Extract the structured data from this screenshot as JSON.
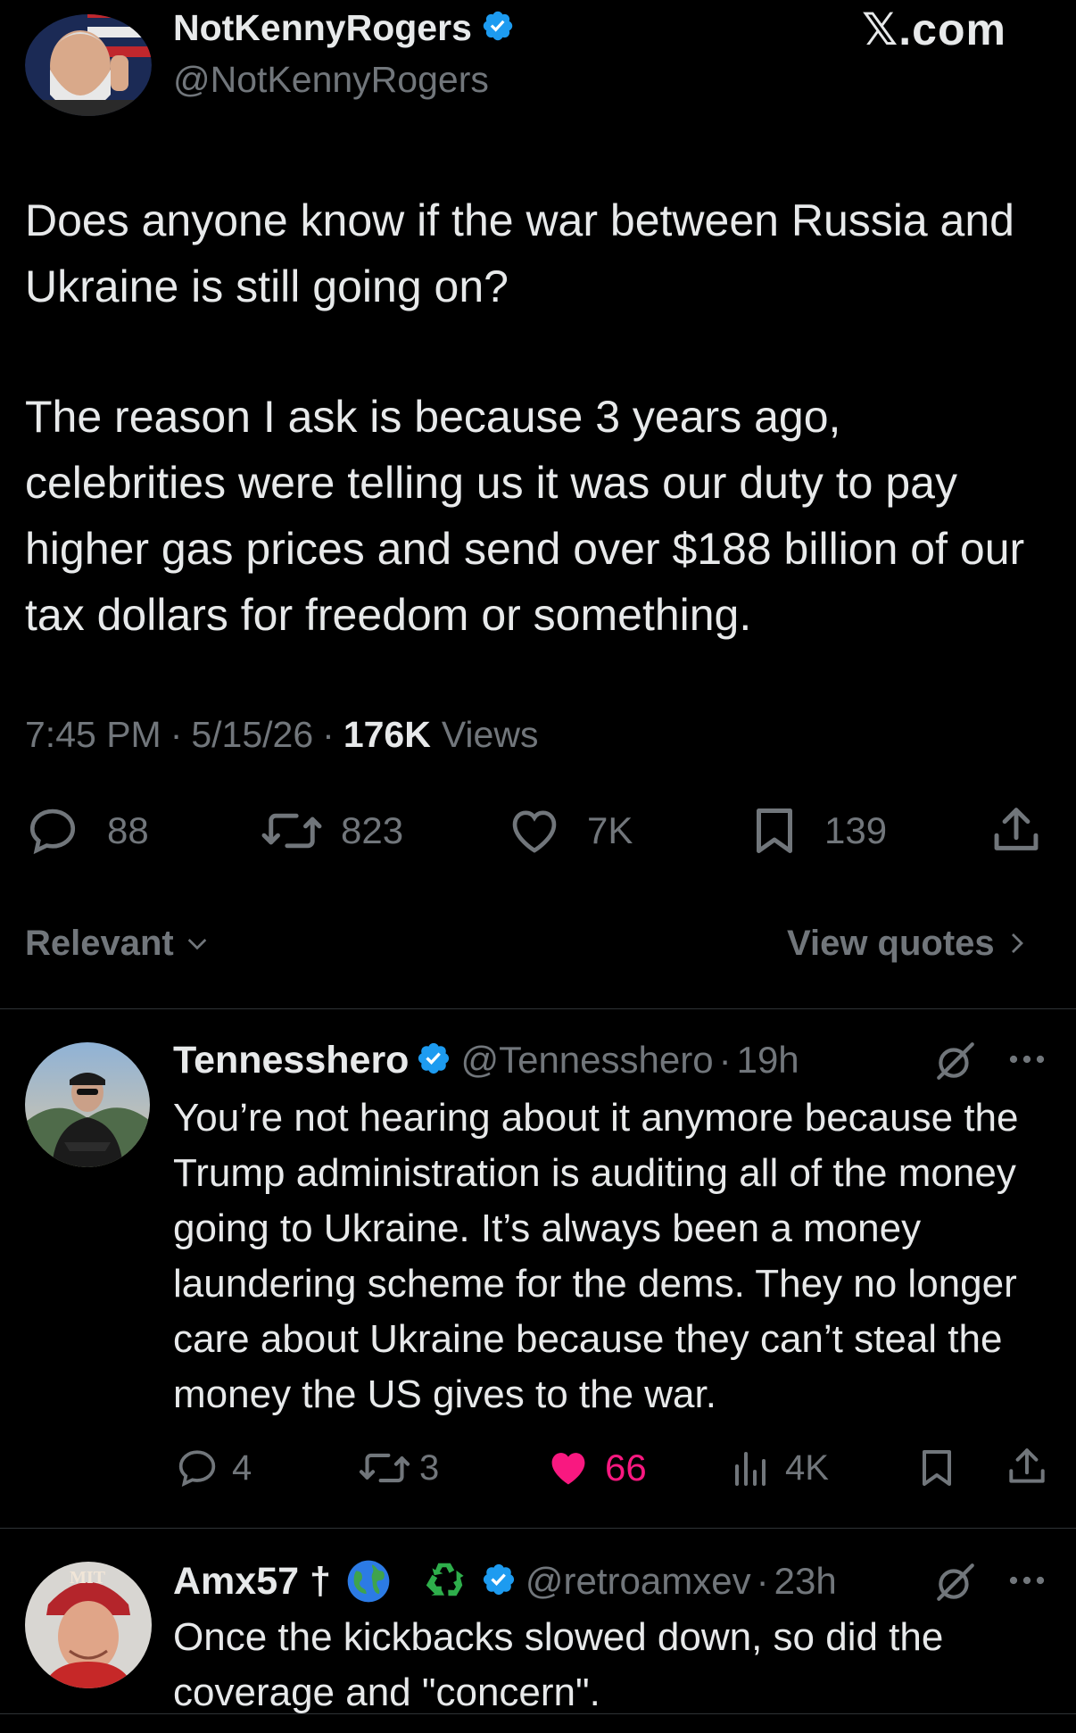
{
  "site_label": "𝕏.com",
  "tweet": {
    "author_name": "NotKennyRogers",
    "author_handle": "@NotKennyRogers",
    "text_para1": "Does anyone know if the war between Russia and Ukraine is still going on?",
    "text_para2": "The reason I ask is because 3 years ago, celebrities were telling us it was our duty to pay higher gas prices and send over $188 billion of our tax dollars for freedom or something.",
    "time": "7:45 PM",
    "date": "5/15/26",
    "views_count": "176K",
    "views_label": "Views",
    "separator": "·",
    "replies": "88",
    "reposts": "823",
    "likes": "7K",
    "bookmarks": "139"
  },
  "sort": {
    "label": "Relevant",
    "view_quotes": "View quotes"
  },
  "replies": [
    {
      "name": "Tennesshero",
      "handle": "@Tennesshero",
      "age": "19h",
      "text": "You’re not hearing about it anymore because the Trump administration is auditing all of the money going to Ukraine. It’s always been a money laundering scheme for the dems. They no longer care about Ukraine because they can’t steal the money the US gives to the war.",
      "replies": "4",
      "reposts": "3",
      "likes": "66",
      "views": "4K"
    },
    {
      "name": "Amx57 †",
      "handle": "@retroamxev",
      "age": "23h",
      "text": "Once the kickbacks slowed down, so did the coverage and \"concern\".",
      "avatar_text": "MIT"
    }
  ],
  "colors": {
    "background": "#000000",
    "text": "#e7e9ea",
    "muted": "#71767b",
    "verified": "#1d9bf0",
    "like_active": "#f91880",
    "divider": "#2f3336"
  }
}
